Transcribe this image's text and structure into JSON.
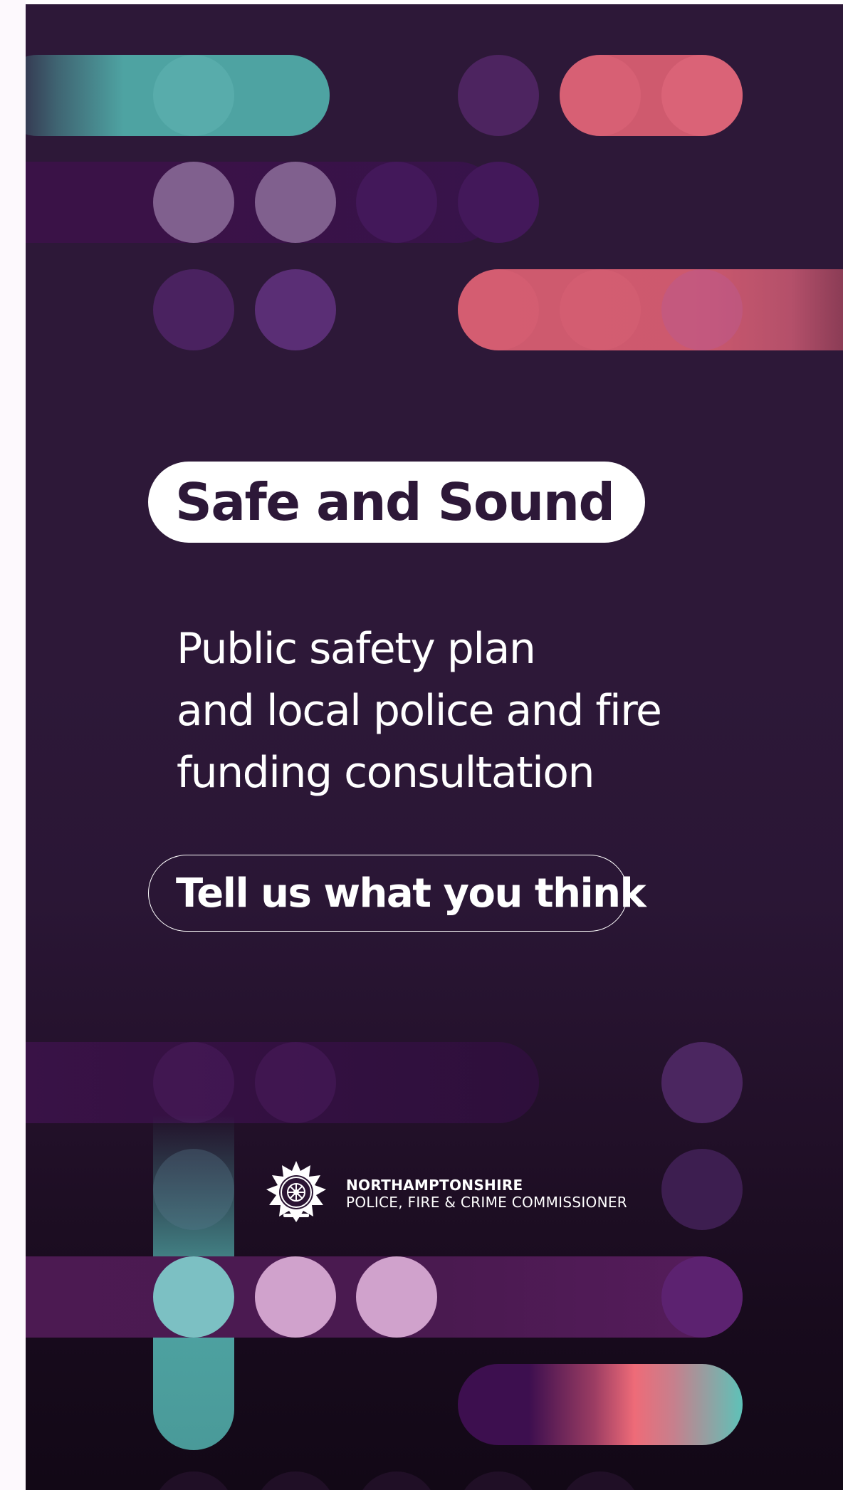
{
  "poster": {
    "title": "Safe and Sound",
    "subtitle_lines": [
      "Public safety plan",
      "and local police and fire",
      "funding consultation"
    ],
    "cta_label": "Tell us what you think"
  },
  "logo": {
    "icon": "fire-crest-icon",
    "line1": "NORTHAMPTONSHIRE",
    "line2": "POLICE, FIRE & CRIME COMMISSIONER"
  },
  "colors": {
    "background": "#2d1838",
    "teal": "#4ea3a2",
    "coral": "#cf5a6e",
    "purple": "#3c1446",
    "lilac": "#d0a2cc",
    "text_dark": "#2d1838"
  }
}
